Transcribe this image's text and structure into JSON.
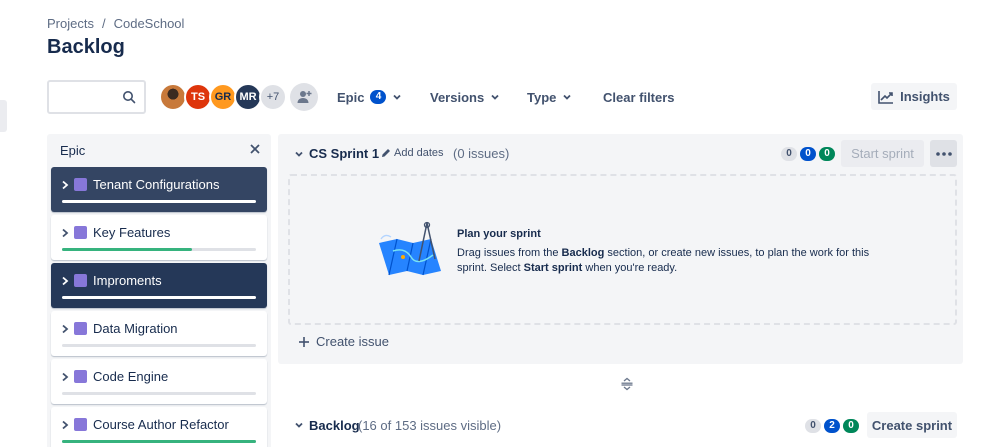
{
  "breadcrumb": {
    "projects": "Projects",
    "separator": "/",
    "project": "CodeSchool"
  },
  "page": {
    "title": "Backlog"
  },
  "search": {
    "placeholder": "",
    "value": ""
  },
  "avatars": [
    {
      "initials": "",
      "kind": "photo"
    },
    {
      "initials": "TS",
      "color": "#de350b"
    },
    {
      "initials": "GR",
      "color": "#ff991f"
    },
    {
      "initials": "MR",
      "color": "#253858"
    },
    {
      "initials": "+7",
      "color": "#dfe1e6"
    }
  ],
  "filters": {
    "epic_label": "Epic",
    "epic_count": "4",
    "versions_label": "Versions",
    "type_label": "Type",
    "clear_label": "Clear filters"
  },
  "insights": {
    "label": "Insights",
    "icon": "trend-chart-icon"
  },
  "epic_panel": {
    "title": "Epic",
    "items": [
      {
        "name": "Tenant Configurations",
        "selected": true,
        "progress": 1.0
      },
      {
        "name": "Key Features",
        "selected": false,
        "progress": 0.67
      },
      {
        "name": "Improments",
        "selected": true,
        "progress": 1.0
      },
      {
        "name": "Data Migration",
        "selected": false,
        "progress": 0
      },
      {
        "name": "Code Engine",
        "selected": false,
        "progress": 0
      },
      {
        "name": "Course Author Refactor",
        "selected": false,
        "progress": 1.0
      }
    ],
    "epic_color": "#8777d9"
  },
  "sprint": {
    "name": "CS Sprint 1",
    "add_dates": "Add dates",
    "issue_count": "(0 issues)",
    "status_counts": {
      "todo": "0",
      "in_progress": "0",
      "done": "0"
    },
    "start_label": "Start sprint",
    "empty": {
      "title": "Plan your sprint",
      "text_1": "Drag issues from the ",
      "text_backlog": "Backlog",
      "text_2": " section, or create new issues, to plan the work for this sprint. Select ",
      "text_start": "Start sprint",
      "text_3": " when you're ready."
    },
    "create_issue": "Create issue"
  },
  "backlog": {
    "name": "Backlog",
    "visible_text": "(16 of 153 issues visible)",
    "status_counts": {
      "todo": "0",
      "in_progress": "2",
      "done": "0"
    },
    "create_sprint": "Create sprint"
  },
  "colors": {
    "accent": "#0052cc",
    "done": "#00875a",
    "progress": "#36b37e",
    "selected_epic": "#344563"
  }
}
